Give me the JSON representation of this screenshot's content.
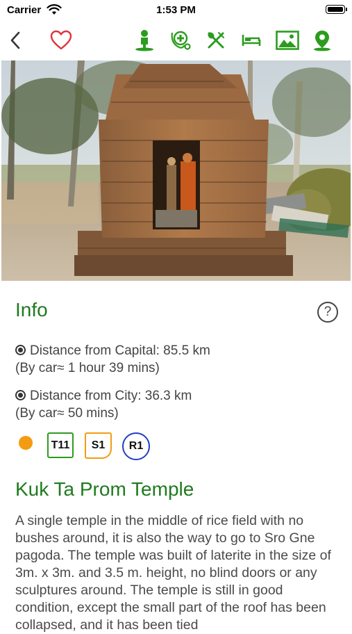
{
  "status_bar": {
    "carrier": "Carrier",
    "time": "1:53 PM"
  },
  "nav": {
    "icons": [
      "back-chevron-icon",
      "heart-icon",
      "person-icon",
      "hospital-icon",
      "restaurant-icon",
      "hotel-icon",
      "photo-gallery-icon",
      "map-pin-icon"
    ]
  },
  "colors": {
    "brand_green": "#1f7a1f",
    "icon_green": "#2b9c1e",
    "heart_red": "#e0323b",
    "orange": "#f39c12",
    "blue": "#1f3fbf"
  },
  "info": {
    "heading": "Info",
    "help": "?",
    "capital_distance": "Distance from Capital: 85.5 km",
    "capital_time": "(By car≈ 1 hour 39 mins)",
    "city_distance": "Distance from City: 36.3 km",
    "city_time": "(By car≈ 50 mins)"
  },
  "badges": {
    "t11": "T11",
    "s1": "S1",
    "r1": "R1"
  },
  "place": {
    "title": "Kuk Ta Prom Temple",
    "description": "A single temple in the middle of rice field with no bushes around, it is also the way to go to Sro Gne pagoda. The temple was built of laterite in the size of 3m. x 3m. and 3.5 m. height, no blind doors or any sculptures around. The temple is still in good condition, except the small part of the roof has been collapsed, and it has been tied"
  }
}
